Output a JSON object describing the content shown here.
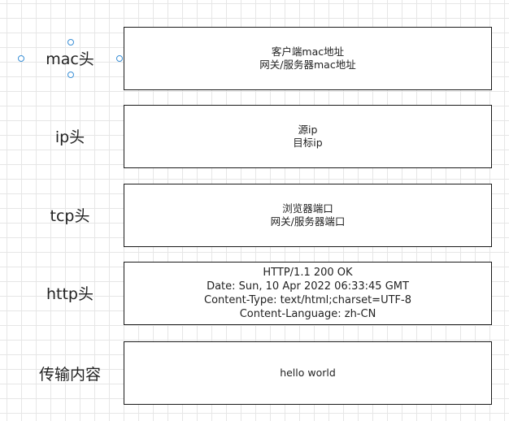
{
  "rows": [
    {
      "label": "mac头",
      "lines": [
        "客户端mac地址",
        "网关/服务器mac地址"
      ]
    },
    {
      "label": "ip头",
      "lines": [
        "源ip",
        "目标ip"
      ]
    },
    {
      "label": "tcp头",
      "lines": [
        "浏览器端口",
        "网关/服务器端口"
      ]
    },
    {
      "label": "http头",
      "lines": [
        "HTTP/1.1 200 OK",
        "Date: Sun, 10 Apr 2022 06:33:45 GMT",
        "Content-Type: text/html;charset=UTF-8",
        "Content-Language: zh-CN"
      ]
    },
    {
      "label": "传输内容",
      "lines": [
        "hello world"
      ]
    }
  ],
  "colors": {
    "selection_handle": "#3a8fd6",
    "box_border": "#1a1a1a",
    "grid": "#e6e6e6"
  }
}
